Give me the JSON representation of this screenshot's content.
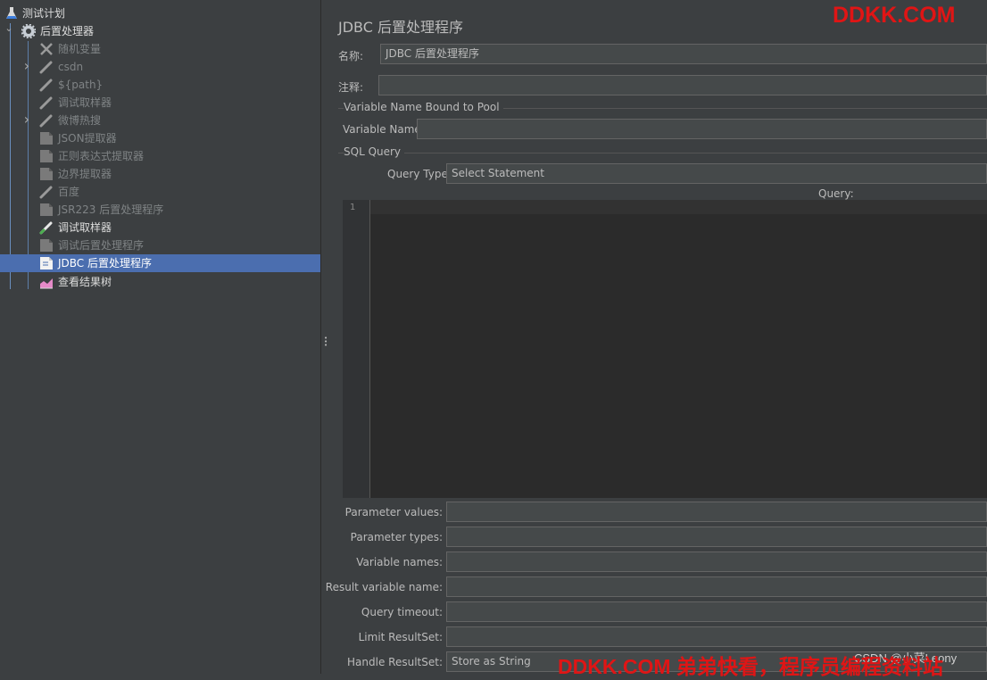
{
  "tree": {
    "items": [
      {
        "label": "测试计划",
        "icon": "test-plan-flask-icon",
        "arrow": ""
      },
      {
        "label": "后置处理器",
        "icon": "gear-icon",
        "arrow": "⌄"
      },
      {
        "label": "随机变量",
        "icon": "scissors-config-icon",
        "arrow": ""
      },
      {
        "label": "csdn",
        "icon": "pen-sampler-icon",
        "arrow": "›"
      },
      {
        "label": "${path}",
        "icon": "pen-sampler-icon",
        "arrow": ""
      },
      {
        "label": "调试取样器",
        "icon": "pen-sampler-icon",
        "arrow": ""
      },
      {
        "label": "微博热搜",
        "icon": "pen-sampler-icon",
        "arrow": "›"
      },
      {
        "label": "JSON提取器",
        "icon": "document-postprocessor-icon",
        "arrow": ""
      },
      {
        "label": "正则表达式提取器",
        "icon": "document-postprocessor-icon",
        "arrow": ""
      },
      {
        "label": "边界提取器",
        "icon": "document-postprocessor-icon",
        "arrow": ""
      },
      {
        "label": "百度",
        "icon": "pen-sampler-icon",
        "arrow": ""
      },
      {
        "label": "JSR223 后置处理程序",
        "icon": "document-postprocessor-icon",
        "arrow": ""
      },
      {
        "label": "调试取样器",
        "icon": "pen-sampler-icon",
        "arrow": ""
      },
      {
        "label": "调试后置处理程序",
        "icon": "document-postprocessor-icon",
        "arrow": ""
      },
      {
        "label": "JDBC 后置处理程序",
        "icon": "document-postprocessor-icon",
        "arrow": ""
      },
      {
        "label": "查看结果树",
        "icon": "results-tree-chart-icon",
        "arrow": ""
      }
    ]
  },
  "panel": {
    "title": "JDBC 后置处理程序",
    "name_label": "名称:",
    "name_value": "JDBC 后置处理程序",
    "comment_label": "注释:",
    "comment_value": "",
    "pool_group_title": "Variable Name Bound to Pool",
    "variable_name_label": "Variable Name:",
    "variable_name_value": "",
    "sql_group_title": "SQL Query",
    "query_type_label": "Query Type:",
    "query_type_value": "Select Statement",
    "query_label": "Query:",
    "editor_line_number": "1",
    "parameter_values_label": "Parameter values:",
    "parameter_types_label": "Parameter types:",
    "variable_names_label": "Variable names:",
    "result_variable_name_label": "Result variable name:",
    "query_timeout_label": "Query timeout:",
    "limit_resultset_label": "Limit ResultSet:",
    "handle_resultset_label": "Handle ResultSet:",
    "handle_resultset_value": "Store as String"
  },
  "watermark": {
    "top": "DDKK.COM",
    "bottom": "DDKK.COM 弟弟快看，程序员编程资料站",
    "csdn_partial": "CSDN @小菜Leony"
  },
  "colors": {
    "background": "#3c3f41",
    "selection": "#4b6eaf",
    "field_bg": "#45494a",
    "editor_bg": "#2b2b2b",
    "watermark": "#e01515"
  }
}
